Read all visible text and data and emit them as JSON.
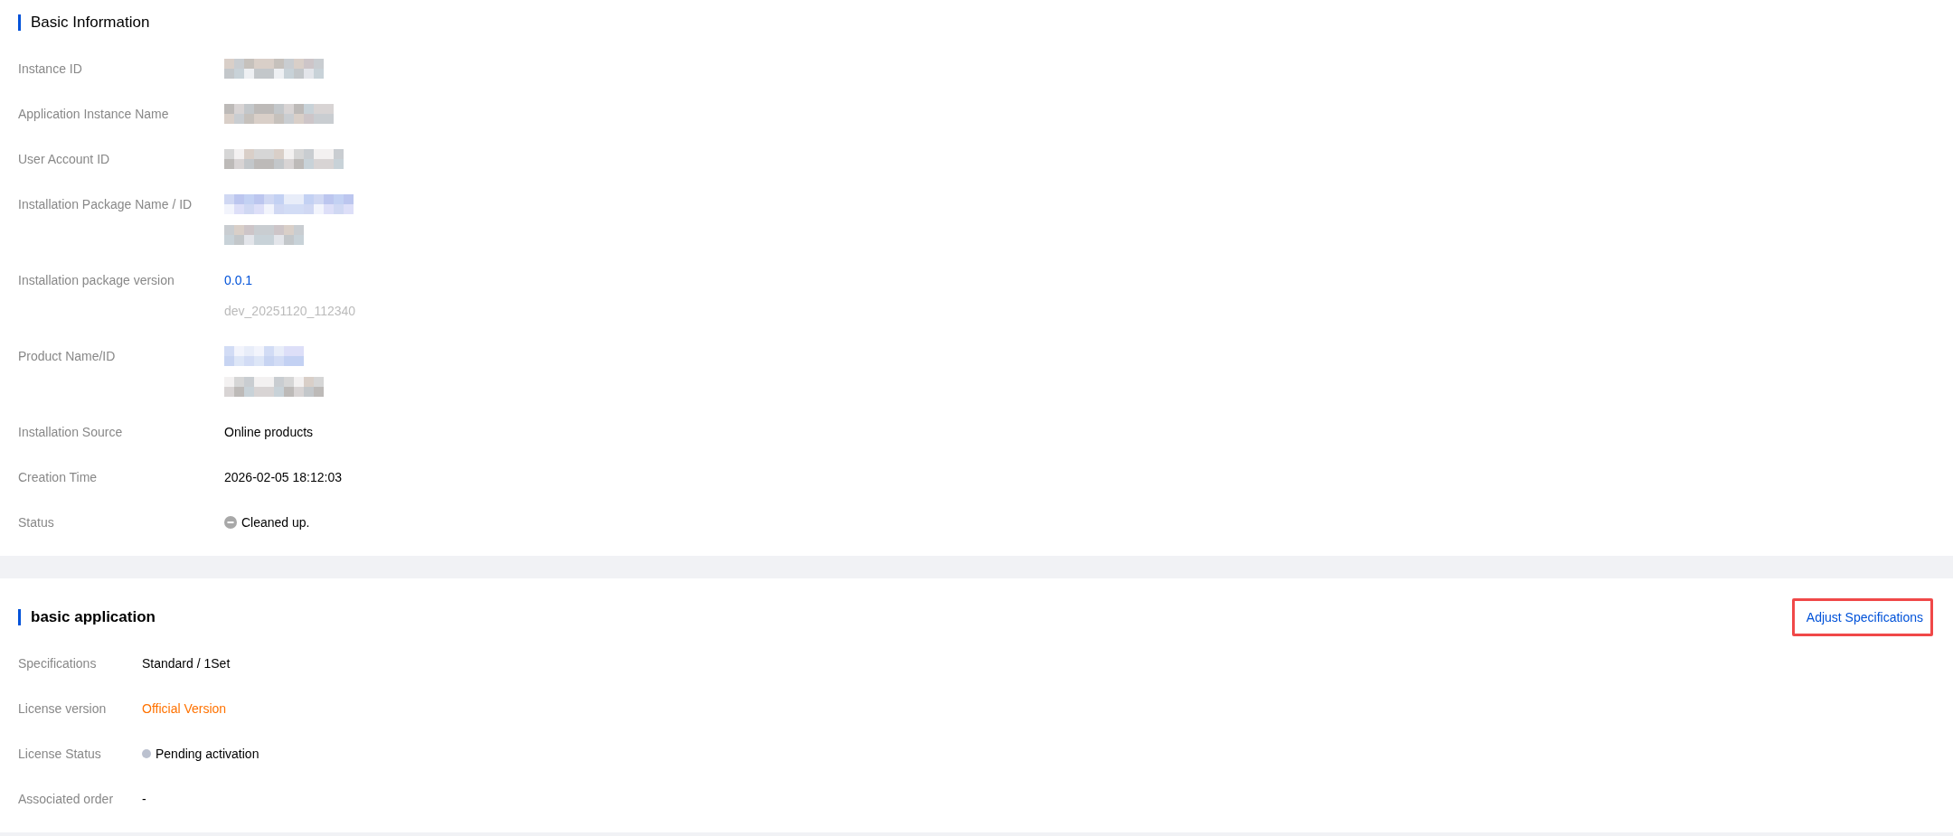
{
  "sections": [
    {
      "title": "Basic Information",
      "rows": [
        {
          "label": "Instance ID",
          "values": [
            {
              "kind": "redacted"
            }
          ]
        },
        {
          "label": "Application Instance Name",
          "values": [
            {
              "kind": "redacted"
            }
          ]
        },
        {
          "label": "User Account ID",
          "values": [
            {
              "kind": "redacted"
            }
          ]
        },
        {
          "label": "Installation Package Name / ID",
          "values": [
            {
              "kind": "redacted-link"
            },
            {
              "kind": "redacted"
            }
          ]
        },
        {
          "label": "Installation package version",
          "values": [
            {
              "kind": "link",
              "text": "0.0.1"
            },
            {
              "kind": "muted",
              "text": "dev_20251120_112340"
            }
          ]
        },
        {
          "label": "Product Name/ID",
          "values": [
            {
              "kind": "redacted-link"
            },
            {
              "kind": "redacted"
            }
          ]
        },
        {
          "label": "Installation Source",
          "values": [
            {
              "kind": "text",
              "text": "Online products"
            }
          ]
        },
        {
          "label": "Creation Time",
          "values": [
            {
              "kind": "text",
              "text": "2026-02-05 18:12:03"
            }
          ]
        },
        {
          "label": "Status",
          "values": [
            {
              "kind": "minus-status",
              "text": "Cleaned up."
            }
          ]
        }
      ]
    },
    {
      "title": "basic application",
      "action": {
        "label": "Adjust Specifications",
        "highlighted": true
      },
      "rows": [
        {
          "label": "Specifications",
          "values": [
            {
              "kind": "text",
              "text": "Standard / 1Set"
            }
          ]
        },
        {
          "label": "License version",
          "values": [
            {
              "kind": "warning",
              "text": "Official Version"
            }
          ]
        },
        {
          "label": "License Status",
          "values": [
            {
              "kind": "dot-status",
              "text": "Pending activation"
            }
          ]
        },
        {
          "label": "Associated order",
          "values": [
            {
              "kind": "text",
              "text": "-"
            }
          ]
        }
      ]
    }
  ]
}
